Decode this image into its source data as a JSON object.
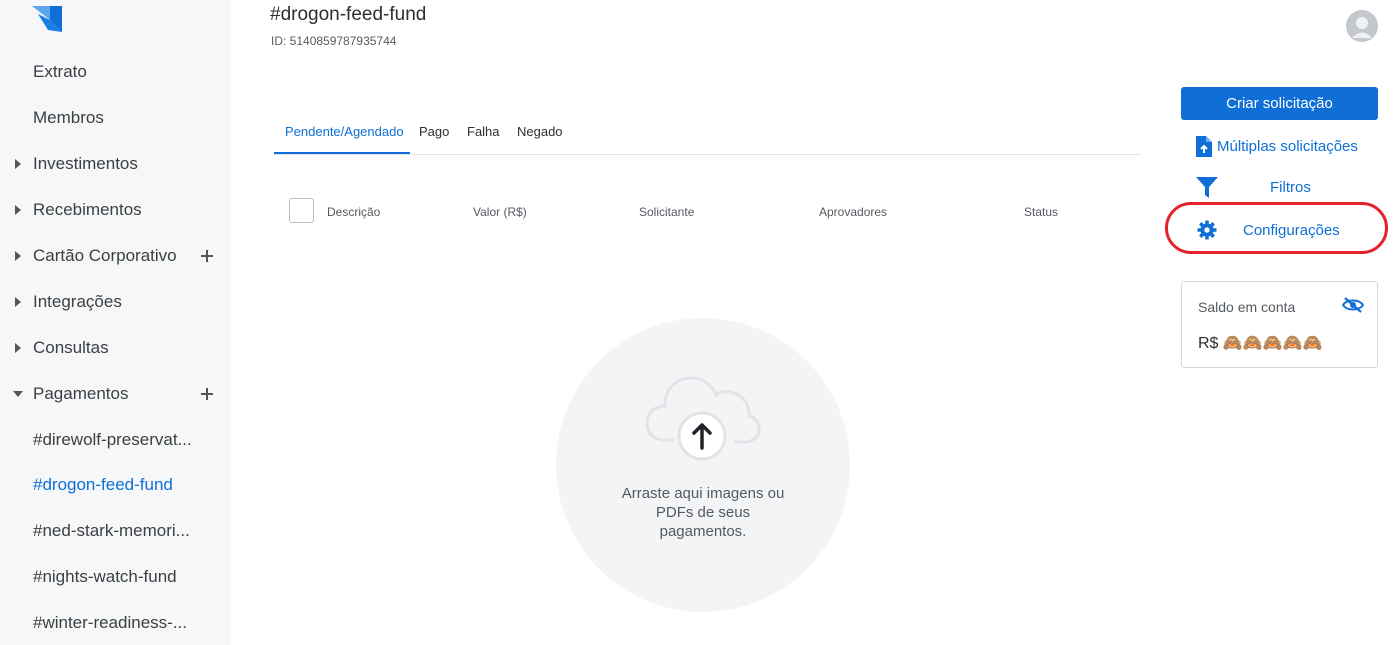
{
  "sidebar": {
    "items": [
      {
        "label": "Extrato"
      },
      {
        "label": "Membros"
      },
      {
        "label": "Investimentos"
      },
      {
        "label": "Recebimentos"
      },
      {
        "label": "Cartão Corporativo"
      },
      {
        "label": "Integrações"
      },
      {
        "label": "Consultas"
      },
      {
        "label": "Pagamentos"
      },
      {
        "label": "#direwolf-preservat..."
      },
      {
        "label": "#drogon-feed-fund"
      },
      {
        "label": "#ned-stark-memori..."
      },
      {
        "label": "#nights-watch-fund"
      },
      {
        "label": "#winter-readiness-..."
      }
    ]
  },
  "header": {
    "title": "#drogon-feed-fund",
    "id": "ID: 5140859787935744"
  },
  "tabs": [
    {
      "label": "Pendente/Agendado"
    },
    {
      "label": "Pago"
    },
    {
      "label": "Falha"
    },
    {
      "label": "Negado"
    }
  ],
  "table": {
    "columns": [
      "Descrição",
      "Valor (R$)",
      "Solicitante",
      "Aprovadores",
      "Status"
    ]
  },
  "dropzone": {
    "text": "Arraste aqui imagens ou PDFs de seus pagamentos."
  },
  "actions": {
    "create": "Criar solicitação",
    "multiple": "Múltiplas solicitações",
    "filters": "Filtros",
    "settings": "Configurações"
  },
  "balance": {
    "title": "Saldo em conta",
    "currency": "R$",
    "masked": "🙈🙈🙈🙈🙈"
  },
  "colors": {
    "accent": "#0f6fd6",
    "highlight": "#e3222a",
    "sidebar_bg": "#f6f7f8"
  }
}
